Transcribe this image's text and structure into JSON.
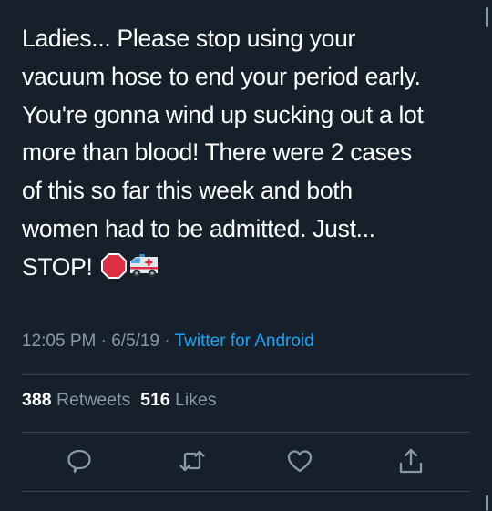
{
  "tweet": {
    "text_lines": [
      "Ladies... Please stop using your",
      "vacuum hose to end your period early.",
      "You're gonna wind up sucking out a lot",
      "more than blood! There were 2 cases",
      "of this so far this week and both",
      "women had to be admitted. Just...",
      "STOP!"
    ],
    "emojis": [
      "stop-sign-icon",
      "ambulance-icon"
    ],
    "time": "12:05 PM",
    "date": "6/5/19",
    "separator": "·",
    "source": "Twitter for Android"
  },
  "stats": {
    "retweets_count": "388",
    "retweets_label": "Retweets",
    "likes_count": "516",
    "likes_label": "Likes"
  },
  "actions": [
    "reply-icon",
    "retweet-icon",
    "like-icon",
    "share-icon"
  ],
  "colors": {
    "background": "#15202b",
    "text": "#ffffff",
    "secondary_text": "#8899a6",
    "link": "#1da1f2",
    "divider": "#38444d"
  }
}
